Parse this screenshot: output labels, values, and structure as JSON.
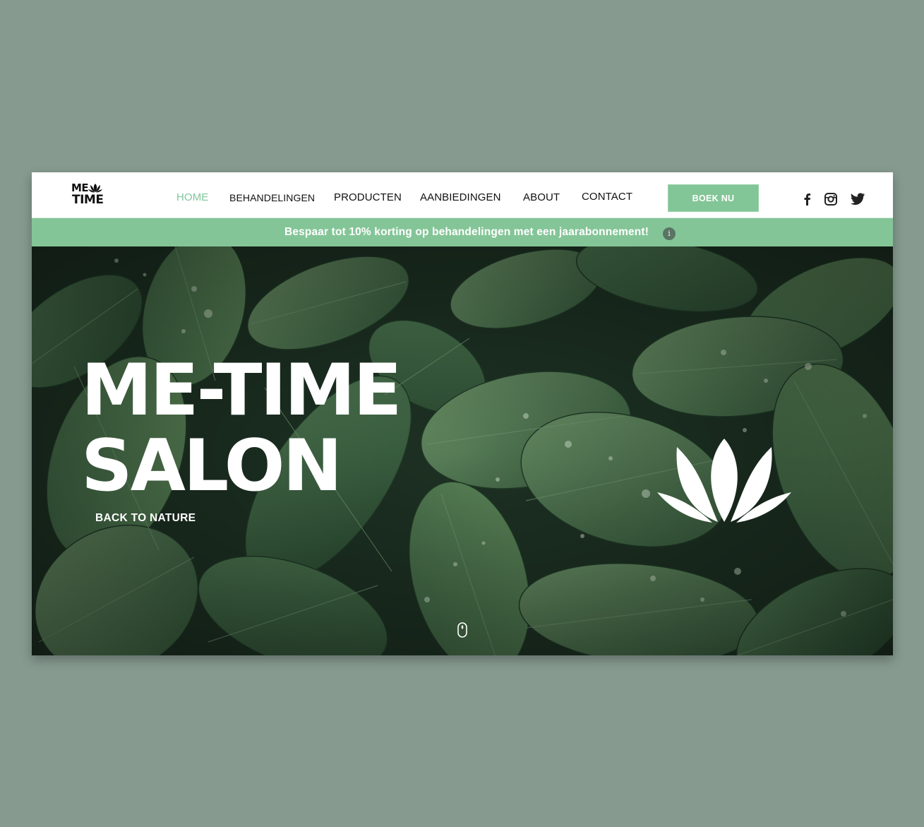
{
  "brand": {
    "logo_line1": "ME",
    "logo_line2": "TIME"
  },
  "nav": {
    "items": [
      {
        "label": "HOME",
        "active": true
      },
      {
        "label": "BEHANDELINGEN",
        "active": false
      },
      {
        "label": "PRODUCTEN",
        "active": false
      },
      {
        "label": "AANBIEDINGEN",
        "active": false
      },
      {
        "label": "ABOUT",
        "active": false
      },
      {
        "label": "CONTACT",
        "active": false
      }
    ],
    "cta_label": "BOEK NU"
  },
  "social": {
    "icons": [
      "facebook-icon",
      "instagram-icon",
      "twitter-icon"
    ]
  },
  "promo": {
    "text": "Bespaar tot 10% korting op behandelingen met een jaarabonnement!",
    "info_glyph": "i"
  },
  "hero": {
    "title_line1": "ME-TIME",
    "title_line2": "SALON",
    "subtitle": "BACK TO NATURE"
  },
  "colors": {
    "page_bg": "#869a8f",
    "accent": "#82c596",
    "active_nav": "#7fc79a",
    "text_dark": "#111111",
    "white": "#ffffff"
  }
}
